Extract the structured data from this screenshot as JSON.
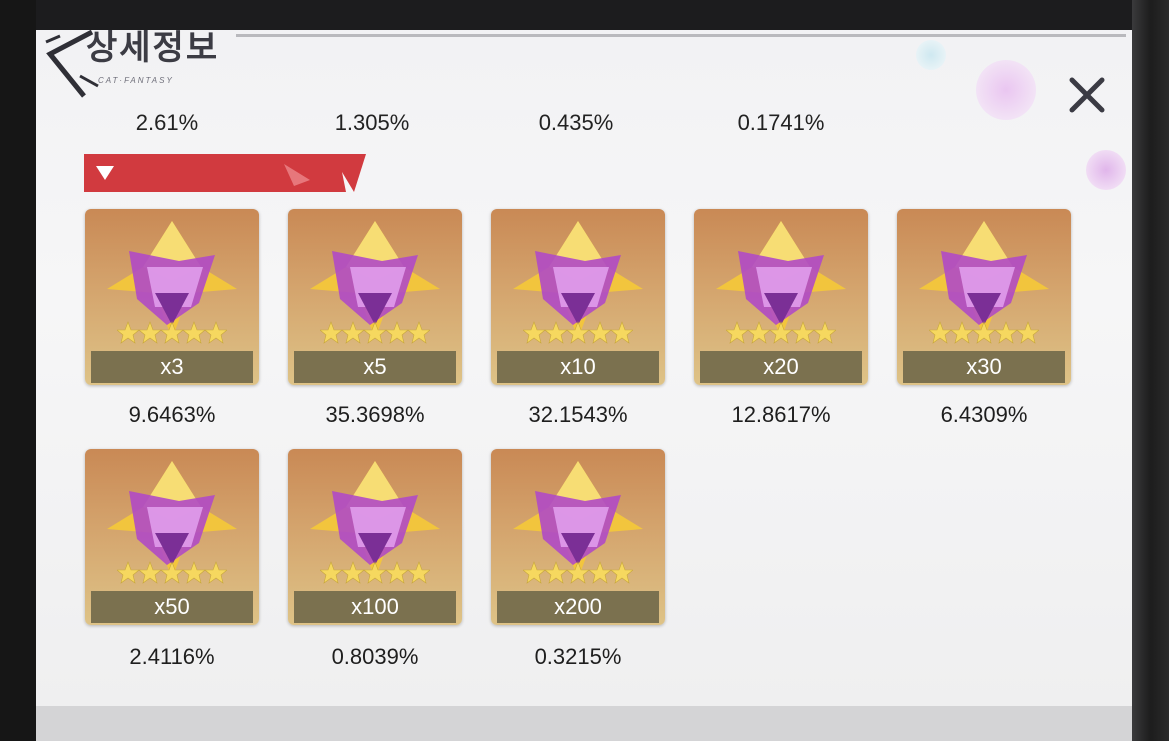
{
  "header": {
    "title": "상세정보",
    "subtitle": "CAT·FANTASY"
  },
  "top_rates": [
    "2.61%",
    "1.305%",
    "0.435%",
    "0.1741%"
  ],
  "rewards": [
    {
      "quantity": "x3",
      "rate": "9.6463%"
    },
    {
      "quantity": "x5",
      "rate": "35.3698%"
    },
    {
      "quantity": "x10",
      "rate": "32.1543%"
    },
    {
      "quantity": "x20",
      "rate": "12.8617%"
    },
    {
      "quantity": "x30",
      "rate": "6.4309%"
    },
    {
      "quantity": "x50",
      "rate": "2.4116%"
    },
    {
      "quantity": "x100",
      "rate": "0.8039%"
    },
    {
      "quantity": "x200",
      "rate": "0.3215%"
    }
  ],
  "icons": {
    "back": "back-arrow-icon",
    "close": "close-icon",
    "section_toggle": "triangle-down-icon",
    "item": "star-crystal-icon"
  },
  "colors": {
    "section_header": "#d13a3f",
    "card_top": "#c98955",
    "card_bottom": "#dec387",
    "quantity_bar": "#7b714f"
  }
}
